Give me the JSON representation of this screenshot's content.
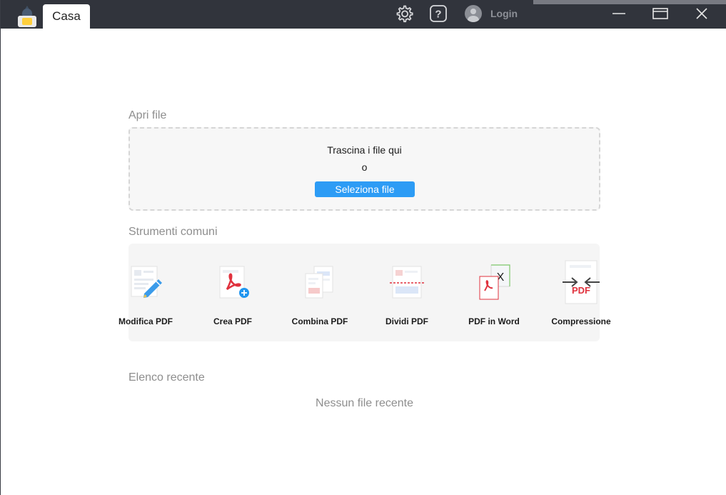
{
  "titlebar": {
    "tab_label": "Casa",
    "login_label": "Login",
    "icons": [
      "app-logo",
      "gear-icon",
      "help-icon",
      "user-avatar-icon",
      "minimize-icon",
      "maximize-icon",
      "close-icon"
    ]
  },
  "open_file": {
    "section_title": "Apri file",
    "drag_text": "Trascina i file qui",
    "or_text": "o",
    "select_button": "Seleziona file"
  },
  "tools": {
    "section_title": "Strumenti comuni",
    "items": [
      {
        "label": "Modifica PDF",
        "icon": "edit-pdf-icon"
      },
      {
        "label": "Crea PDF",
        "icon": "create-pdf-icon"
      },
      {
        "label": "Combina PDF",
        "icon": "combine-pdf-icon"
      },
      {
        "label": "Dividi PDF",
        "icon": "split-pdf-icon"
      },
      {
        "label": "PDF in Word",
        "icon": "pdf-to-word-icon"
      },
      {
        "label": "Compressione",
        "icon": "compress-icon"
      }
    ]
  },
  "recent": {
    "section_title": "Elenco recente",
    "empty_message": "Nessun file recente"
  },
  "colors": {
    "titlebar": "#31343c",
    "accent": "#2d9cf5",
    "pdf_red": "#e0323e"
  }
}
